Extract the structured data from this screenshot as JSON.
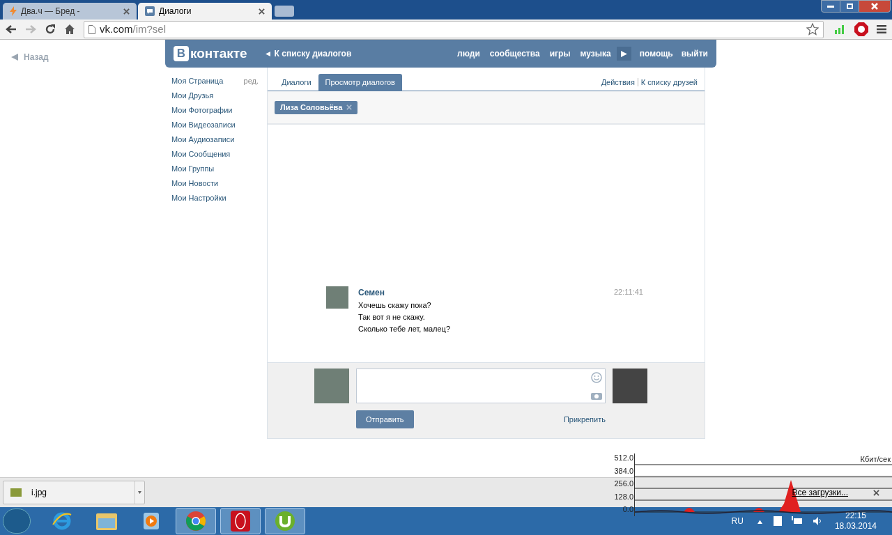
{
  "browser": {
    "tabs": [
      {
        "title": "Два.ч — Бред -",
        "kind": "bolt",
        "selected": false
      },
      {
        "title": "Диалоги",
        "kind": "chat",
        "selected": true
      }
    ],
    "url": {
      "host": "vk.com",
      "path": "/im?sel"
    }
  },
  "page": {
    "back": "Назад",
    "header": {
      "logo_mark": "В",
      "logo_text": "контакте",
      "back_link": "К списку диалогов",
      "nav": [
        "люди",
        "сообщества",
        "игры",
        "музыка"
      ],
      "nav_right": [
        "помощь",
        "выйти"
      ]
    },
    "sidebar": {
      "items": [
        {
          "label": "Моя Страница",
          "edit": "ред."
        },
        {
          "label": "Мои Друзья"
        },
        {
          "label": "Мои Фотографии"
        },
        {
          "label": "Мои Видеозаписи"
        },
        {
          "label": "Мои Аудиозаписи"
        },
        {
          "label": "Мои Сообщения"
        },
        {
          "label": "Мои Группы"
        },
        {
          "label": "Мои Новости"
        },
        {
          "label": "Мои Настройки"
        }
      ]
    },
    "tabs": [
      {
        "label": "Диалоги",
        "selected": false
      },
      {
        "label": "Просмотр диалогов",
        "selected": true
      }
    ],
    "actions": [
      "Действия",
      "К списку друзей"
    ],
    "chip": "Лиза Соловьёва",
    "message": {
      "author": "Семен",
      "time": "22:11:41",
      "lines": [
        "Хочешь скажу пока?",
        "Так вот я не скажу.",
        "Сколько тебе лет, малец?"
      ]
    },
    "composer": {
      "send": "Отправить",
      "attach": "Прикрепить"
    }
  },
  "download_bar": {
    "file": "i.jpg",
    "all": "Все загрузки..."
  },
  "traffic_monitor": {
    "unit": "Кбит/сек",
    "yticks": [
      "512.0",
      "384.0",
      "256.0",
      "128.0",
      "0.0"
    ]
  },
  "taskbar": {
    "apps": [
      {
        "kind": "ie",
        "running": false
      },
      {
        "kind": "folder",
        "running": false
      },
      {
        "kind": "media",
        "running": false
      },
      {
        "kind": "chrome",
        "running": true
      },
      {
        "kind": "opera",
        "running": true
      },
      {
        "kind": "torrent",
        "running": true
      }
    ],
    "lang": "RU",
    "time": "22:15",
    "date": "18.03.2014"
  }
}
